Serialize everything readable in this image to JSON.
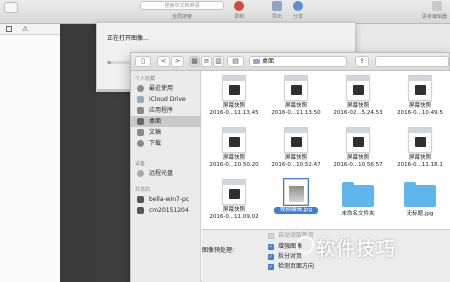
{
  "toolbar": {
    "search_placeholder": "搜索中文档英语",
    "search_label": "全局搜索",
    "label_import": "导出",
    "label_share": "分享",
    "label_record": "录制",
    "label_prefs": "思考编辑器"
  },
  "opening_dialog": {
    "title": "正在打开图像…",
    "progress_fraction": 0.15
  },
  "file_panel": {
    "location": "桌面",
    "nav_back": "<",
    "nav_forward": ">",
    "sidebar": {
      "favorites_title": "个人收藏",
      "favorites": [
        {
          "label": "最近使用",
          "icon": "clock-icon"
        },
        {
          "label": "iCloud Drive",
          "icon": "cloud-icon"
        },
        {
          "label": "应用程序",
          "icon": "apps-icon"
        },
        {
          "label": "桌面",
          "icon": "desktop-icon",
          "selected": true
        },
        {
          "label": "文稿",
          "icon": "document-icon"
        },
        {
          "label": "下载",
          "icon": "download-icon"
        }
      ],
      "devices_title": "设备",
      "devices": [
        {
          "label": "远程光盘",
          "icon": "disc-icon"
        }
      ],
      "shared_title": "共享的",
      "shared": [
        {
          "label": "bella-win7-pc",
          "icon": "computer-icon"
        },
        {
          "label": "cm20151204",
          "icon": "computer-icon"
        }
      ]
    },
    "files": [
      {
        "name": "屏幕快照",
        "date": "2016-0...11.13.45",
        "kind": "screenshot"
      },
      {
        "name": "屏幕快照",
        "date": "2016-0...11.13.50",
        "kind": "screenshot"
      },
      {
        "name": "屏幕快照",
        "date": "2016-02...5.24.53",
        "kind": "screenshot"
      },
      {
        "name": "屏幕快照",
        "date": "2016-0...10.49.5",
        "kind": "screenshot"
      },
      {
        "name": "屏幕快照",
        "date": "2016-0...10.50.20",
        "kind": "screenshot"
      },
      {
        "name": "屏幕快照",
        "date": "2016-0...10.52.47",
        "kind": "screenshot"
      },
      {
        "name": "屏幕快照",
        "date": "2016-0...10.56.57",
        "kind": "screenshot"
      },
      {
        "name": "屏幕快照",
        "date": "2016-0...11.18.1",
        "kind": "screenshot"
      },
      {
        "name": "屏幕快照",
        "date": "2016-0...11.09.02",
        "kind": "screenshot"
      },
      {
        "name": "视频编辑.jpg",
        "date": "",
        "kind": "image",
        "selected": true
      },
      {
        "name": "未命名文件夹",
        "date": "",
        "kind": "folder"
      },
      {
        "name": "无标题.jpg",
        "date": "",
        "kind": "folder"
      }
    ],
    "options": {
      "label": "图像预处理:",
      "checkboxes": [
        {
          "label": "自动读取新页",
          "checked": true,
          "disabled": true
        },
        {
          "label": "增强图像",
          "checked": true
        },
        {
          "label": "拆分对页",
          "checked": true
        },
        {
          "label": "检测页面方向",
          "checked": true
        }
      ]
    }
  },
  "watermark": "软件技巧",
  "colors": {
    "accent": "#3e7fd6",
    "folder": "#5fb6ee",
    "dark_bg": "#3a3a3a"
  }
}
